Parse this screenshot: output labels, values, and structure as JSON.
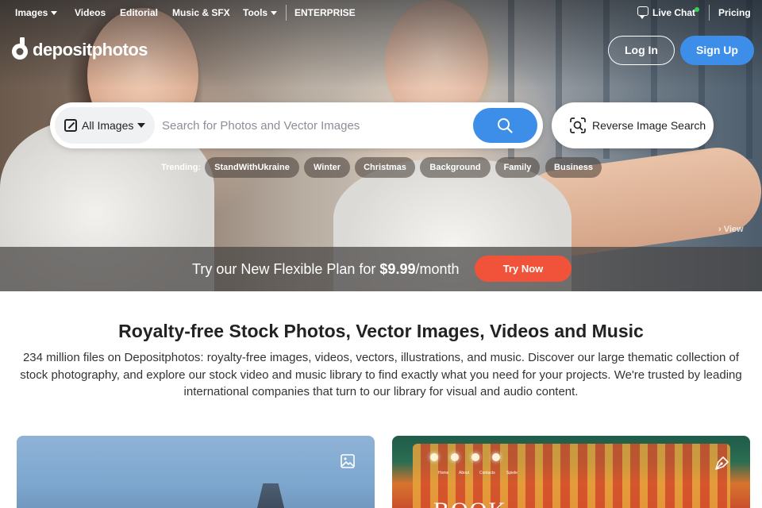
{
  "topnav": {
    "items": [
      {
        "label": "Images",
        "has_caret": true
      },
      {
        "label": "Videos"
      },
      {
        "label": "Editorial"
      },
      {
        "label": "Music & SFX"
      },
      {
        "label": "Tools",
        "has_caret": true
      },
      {
        "label": "ENTERPRISE"
      }
    ],
    "live_chat": "Live Chat",
    "pricing": "Pricing"
  },
  "logo": {
    "text": "depositphotos"
  },
  "auth": {
    "login": "Log In",
    "signup": "Sign Up"
  },
  "search": {
    "type": "All Images",
    "placeholder": "Search for Photos and Vector Images",
    "reverse_label": "Reverse Image Search"
  },
  "trending": {
    "label": "Trending:",
    "chips": [
      "StandWithUkraine",
      "Winter",
      "Christmas",
      "Background",
      "Family",
      "Business"
    ]
  },
  "hero": {
    "view_label": "View"
  },
  "promo": {
    "text_before": "Try our New Flexible Plan for ",
    "price": "$9.99",
    "text_after": "/month",
    "cta": "Try Now"
  },
  "main": {
    "title": "Royalty-free Stock Photos, Vector Images, Videos and Music",
    "description": "234 million files on Depositphotos: royalty-free images, videos, vectors, illustrations, and music. Discover our large thematic collection of stock photography, and explore our stock video and music library to find exactly what you need for your projects. We're trusted by leading international companies that turn to our library for visual and audio content."
  },
  "cards": {
    "right_text": "BOOK",
    "mini_nav": [
      "Home",
      "About",
      "Contacts",
      "Spiele"
    ]
  },
  "colors": {
    "accent_blue": "#3d8ee8",
    "cta_red": "#f0533a",
    "online_green": "#39d353"
  },
  "icons": [
    "image-type-icon",
    "search-icon",
    "reverse-search-icon",
    "chat-icon",
    "image-icon",
    "vector-pen-icon",
    "chevron-right-icon"
  ]
}
